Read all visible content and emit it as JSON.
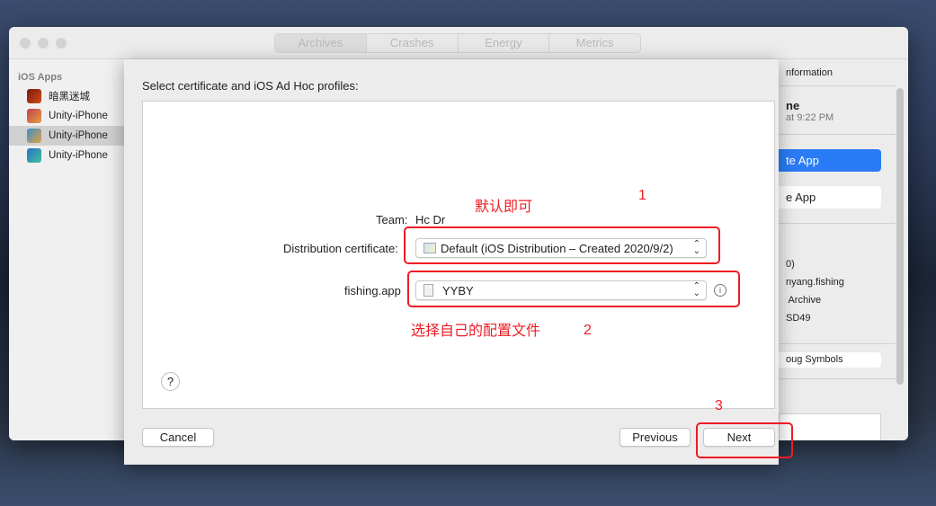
{
  "window": {
    "tabs": [
      "Archives",
      "Crashes",
      "Energy",
      "Metrics"
    ],
    "active_tab": "Archives"
  },
  "sidebar": {
    "header": "iOS Apps",
    "items": [
      {
        "label": "暗黑迷城"
      },
      {
        "label": "Unity-iPhone"
      },
      {
        "label": "Unity-iPhone",
        "selected": true
      },
      {
        "label": "Unity-iPhone"
      }
    ]
  },
  "right_panel": {
    "header": "nformation",
    "title": "ne",
    "date": "at 9:22 PM",
    "distribute_button": "te App",
    "validate_button": "e App",
    "lines": [
      "0)",
      "nyang.fishing",
      " Archive",
      "SD49"
    ],
    "symbols_button": "oug Symbols"
  },
  "sheet": {
    "heading": "Select certificate and iOS Ad Hoc profiles:",
    "team_label": "Team:",
    "team_value": "Hc Dr",
    "cert_label": "Distribution certificate:",
    "cert_value": "Default (iOS Distribution – Created 2020/9/2)",
    "app_label": "fishing.app",
    "profile_value": "YYBY",
    "help": "?",
    "cancel": "Cancel",
    "previous": "Previous",
    "next": "Next"
  },
  "annotations": {
    "note1": "默认即可",
    "num1": "1",
    "note2": "选择自己的配置文件",
    "num2": "2",
    "num3": "3",
    "color": "#ee1c24"
  },
  "colors": {
    "accent": "#2a7cf6"
  }
}
